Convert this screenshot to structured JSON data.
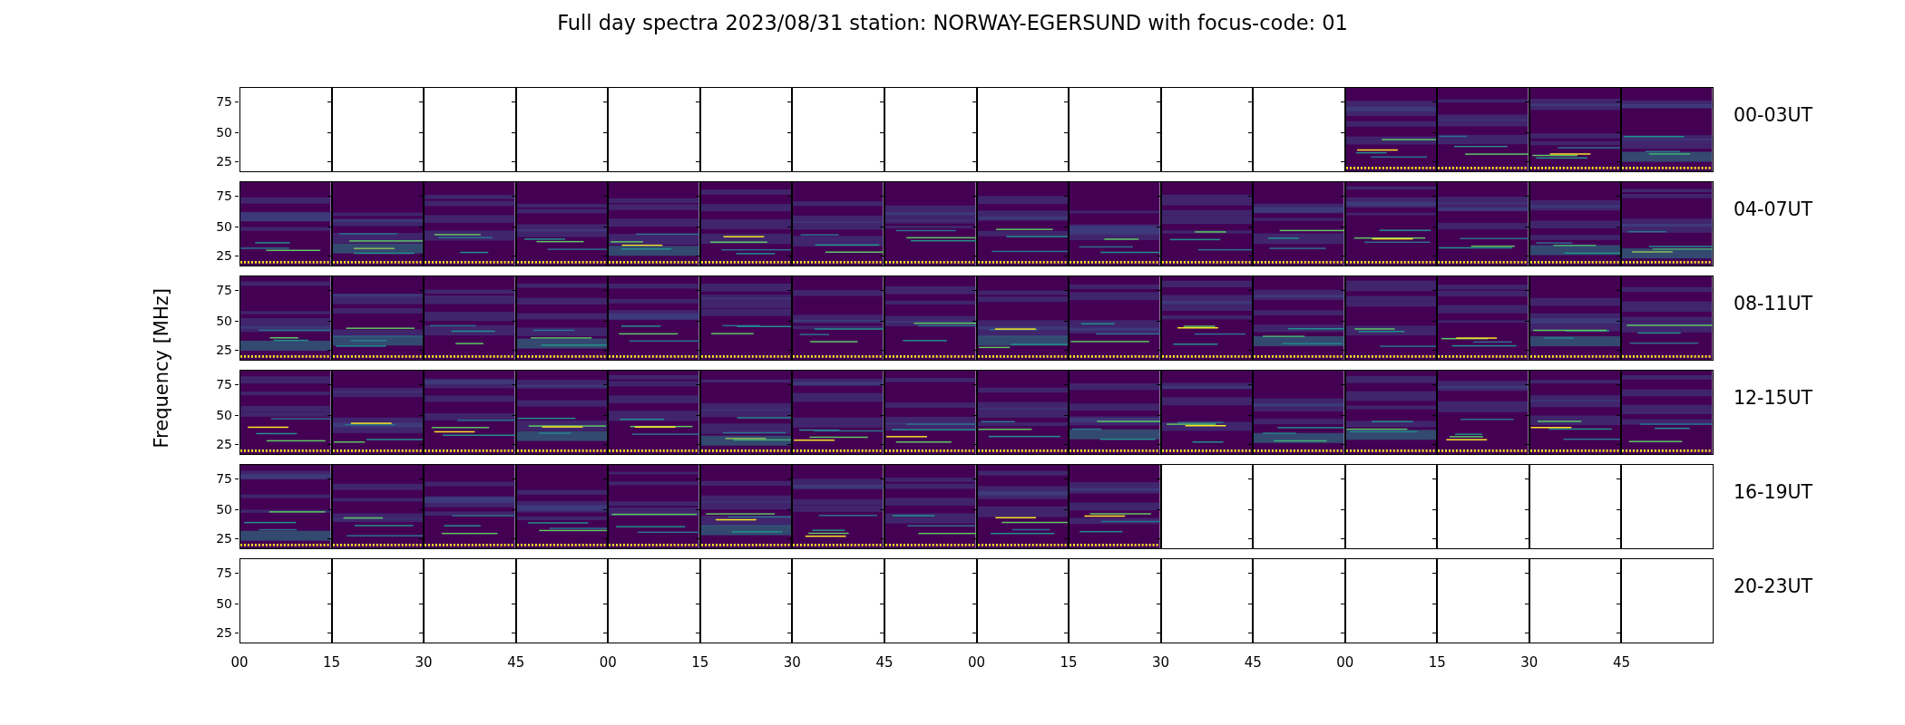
{
  "title": "Full day spectra 2023/08/31 station: NORWAY-EGERSUND with focus-code: 01",
  "y_axis_label": "Frequency [MHz]",
  "x_tick_labels": [
    "00",
    "15",
    "30",
    "45",
    "00",
    "15",
    "30",
    "45",
    "00",
    "15",
    "30",
    "45",
    "00",
    "15",
    "30",
    "45"
  ],
  "rows": [
    {
      "label": "00-03UT",
      "y_ticks": [
        "75",
        "50",
        "25"
      ],
      "panels": [
        {
          "has_data": false
        },
        {
          "has_data": false
        },
        {
          "has_data": false
        },
        {
          "has_data": false
        },
        {
          "has_data": false
        },
        {
          "has_data": false
        },
        {
          "has_data": false
        },
        {
          "has_data": false
        },
        {
          "has_data": false
        },
        {
          "has_data": false
        },
        {
          "has_data": false
        },
        {
          "has_data": false
        },
        {
          "has_data": true
        },
        {
          "has_data": true
        },
        {
          "has_data": true
        },
        {
          "has_data": true
        }
      ]
    },
    {
      "label": "04-07UT",
      "y_ticks": [
        "75",
        "50",
        "25"
      ],
      "panels": [
        {
          "has_data": true
        },
        {
          "has_data": true
        },
        {
          "has_data": true
        },
        {
          "has_data": true
        },
        {
          "has_data": true
        },
        {
          "has_data": true
        },
        {
          "has_data": true
        },
        {
          "has_data": true
        },
        {
          "has_data": true
        },
        {
          "has_data": true
        },
        {
          "has_data": true
        },
        {
          "has_data": true
        },
        {
          "has_data": true
        },
        {
          "has_data": true
        },
        {
          "has_data": true
        },
        {
          "has_data": true
        }
      ]
    },
    {
      "label": "08-11UT",
      "y_ticks": [
        "75",
        "50",
        "25"
      ],
      "panels": [
        {
          "has_data": true
        },
        {
          "has_data": true
        },
        {
          "has_data": true
        },
        {
          "has_data": true
        },
        {
          "has_data": true
        },
        {
          "has_data": true
        },
        {
          "has_data": true
        },
        {
          "has_data": true
        },
        {
          "has_data": true
        },
        {
          "has_data": true
        },
        {
          "has_data": true
        },
        {
          "has_data": true
        },
        {
          "has_data": true
        },
        {
          "has_data": true
        },
        {
          "has_data": true
        },
        {
          "has_data": true
        }
      ]
    },
    {
      "label": "12-15UT",
      "y_ticks": [
        "75",
        "50",
        "25"
      ],
      "panels": [
        {
          "has_data": true
        },
        {
          "has_data": true
        },
        {
          "has_data": true
        },
        {
          "has_data": true
        },
        {
          "has_data": true
        },
        {
          "has_data": true
        },
        {
          "has_data": true
        },
        {
          "has_data": true
        },
        {
          "has_data": true
        },
        {
          "has_data": true
        },
        {
          "has_data": true
        },
        {
          "has_data": true
        },
        {
          "has_data": true
        },
        {
          "has_data": true
        },
        {
          "has_data": true
        },
        {
          "has_data": true
        }
      ]
    },
    {
      "label": "16-19UT",
      "y_ticks": [
        "75",
        "50",
        "25"
      ],
      "panels": [
        {
          "has_data": true
        },
        {
          "has_data": true
        },
        {
          "has_data": true
        },
        {
          "has_data": true
        },
        {
          "has_data": true
        },
        {
          "has_data": true
        },
        {
          "has_data": true
        },
        {
          "has_data": true
        },
        {
          "has_data": true
        },
        {
          "has_data": true
        },
        {
          "has_data": false
        },
        {
          "has_data": false
        },
        {
          "has_data": false
        },
        {
          "has_data": false
        },
        {
          "has_data": false
        },
        {
          "has_data": false
        }
      ]
    },
    {
      "label": "20-23UT",
      "y_ticks": [
        "75",
        "50",
        "25"
      ],
      "panels": [
        {
          "has_data": false
        },
        {
          "has_data": false
        },
        {
          "has_data": false
        },
        {
          "has_data": false
        },
        {
          "has_data": false
        },
        {
          "has_data": false
        },
        {
          "has_data": false
        },
        {
          "has_data": false
        },
        {
          "has_data": false
        },
        {
          "has_data": false
        },
        {
          "has_data": false
        },
        {
          "has_data": false
        },
        {
          "has_data": false
        },
        {
          "has_data": false
        },
        {
          "has_data": false
        },
        {
          "has_data": false
        }
      ]
    }
  ]
}
